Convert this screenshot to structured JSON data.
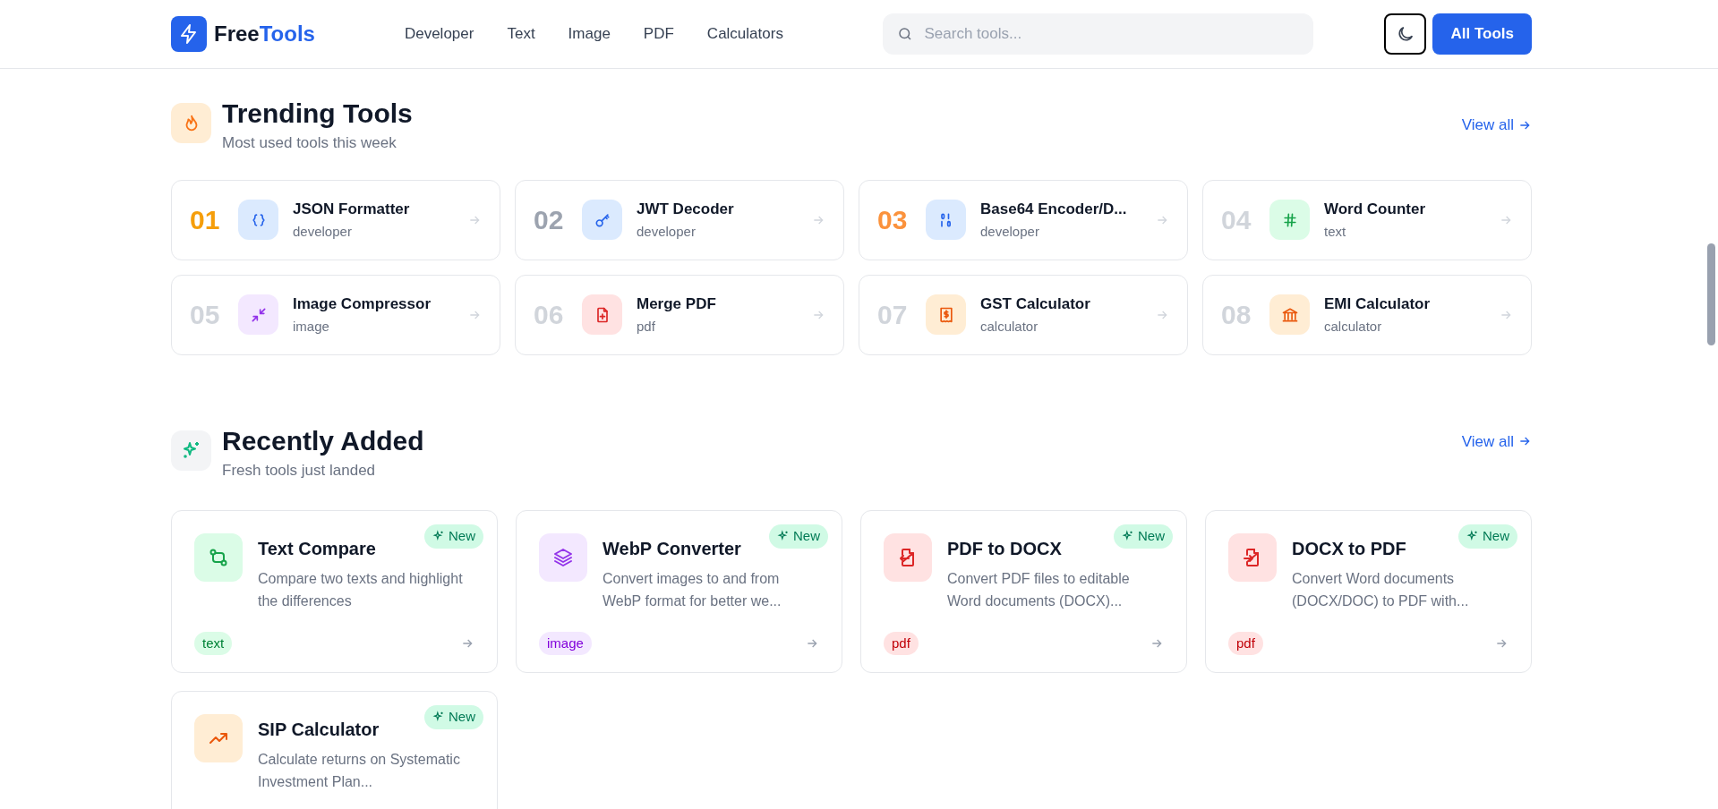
{
  "header": {
    "logo": {
      "first": "Free",
      "second": "Tools"
    },
    "nav": [
      "Developer",
      "Text",
      "Image",
      "PDF",
      "Calculators"
    ],
    "search": {
      "placeholder": "Search tools..."
    },
    "all_tools_button": "All Tools"
  },
  "trending": {
    "title": "Trending Tools",
    "subtitle": "Most used tools this week",
    "view_all": "View all",
    "items": [
      {
        "rank": "01",
        "color": "#f59e0b",
        "kind": "braces",
        "name": "JSON Formatter",
        "category": "developer"
      },
      {
        "rank": "02",
        "color": "#9ca3af",
        "kind": "key",
        "name": "JWT Decoder",
        "category": "developer"
      },
      {
        "rank": "03",
        "color": "#fb923c",
        "kind": "binary",
        "name": "Base64 Encoder/D...",
        "category": "developer"
      },
      {
        "rank": "04",
        "color": "#d1d5db",
        "kind": "hash",
        "name": "Word Counter",
        "category": "text"
      },
      {
        "rank": "05",
        "color": "#d1d5db",
        "kind": "shrink",
        "name": "Image Compressor",
        "category": "image"
      },
      {
        "rank": "06",
        "color": "#d1d5db",
        "kind": "file-plus",
        "name": "Merge PDF",
        "category": "pdf"
      },
      {
        "rank": "07",
        "color": "#d1d5db",
        "kind": "receipt",
        "name": "GST Calculator",
        "category": "calculator"
      },
      {
        "rank": "08",
        "color": "#d1d5db",
        "kind": "bank",
        "name": "EMI Calculator",
        "category": "calculator"
      }
    ]
  },
  "recent": {
    "title": "Recently Added",
    "subtitle": "Fresh tools just landed",
    "view_all": "View all",
    "items": [
      {
        "kind": "compare",
        "name": "Text Compare",
        "badge": "New",
        "description": "Compare two texts and highlight the differences",
        "tag": "text"
      },
      {
        "kind": "layers",
        "name": "WebP Converter",
        "badge": "New",
        "description": "Convert images to and from WebP format for better we...",
        "tag": "image"
      },
      {
        "kind": "file-out",
        "name": "PDF to DOCX",
        "badge": "New",
        "description": "Convert PDF files to editable Word documents (DOCX)...",
        "tag": "pdf"
      },
      {
        "kind": "file-in",
        "name": "DOCX to PDF",
        "badge": "New",
        "description": "Convert Word documents (DOCX/DOC) to PDF with...",
        "tag": "pdf"
      },
      {
        "kind": "trend",
        "name": "SIP Calculator",
        "badge": "New",
        "description": "Calculate returns on Systematic Investment Plan..."
      }
    ]
  }
}
